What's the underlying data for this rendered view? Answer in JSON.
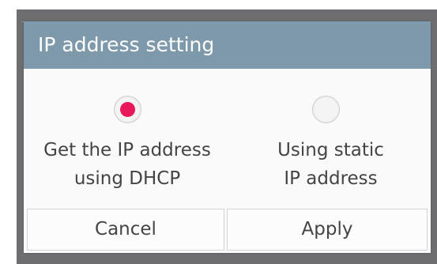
{
  "dialog": {
    "title": "IP address setting",
    "options": [
      {
        "line1": "Get the IP address",
        "line2": "using DHCP",
        "selected": true
      },
      {
        "line1": "Using static",
        "line2": "IP address",
        "selected": false
      }
    ],
    "buttons": {
      "cancel": "Cancel",
      "apply": "Apply"
    }
  },
  "colors": {
    "title_bar": "#7e99ab",
    "radio_selected": "#e8195a",
    "backdrop": "#6e6e70"
  }
}
